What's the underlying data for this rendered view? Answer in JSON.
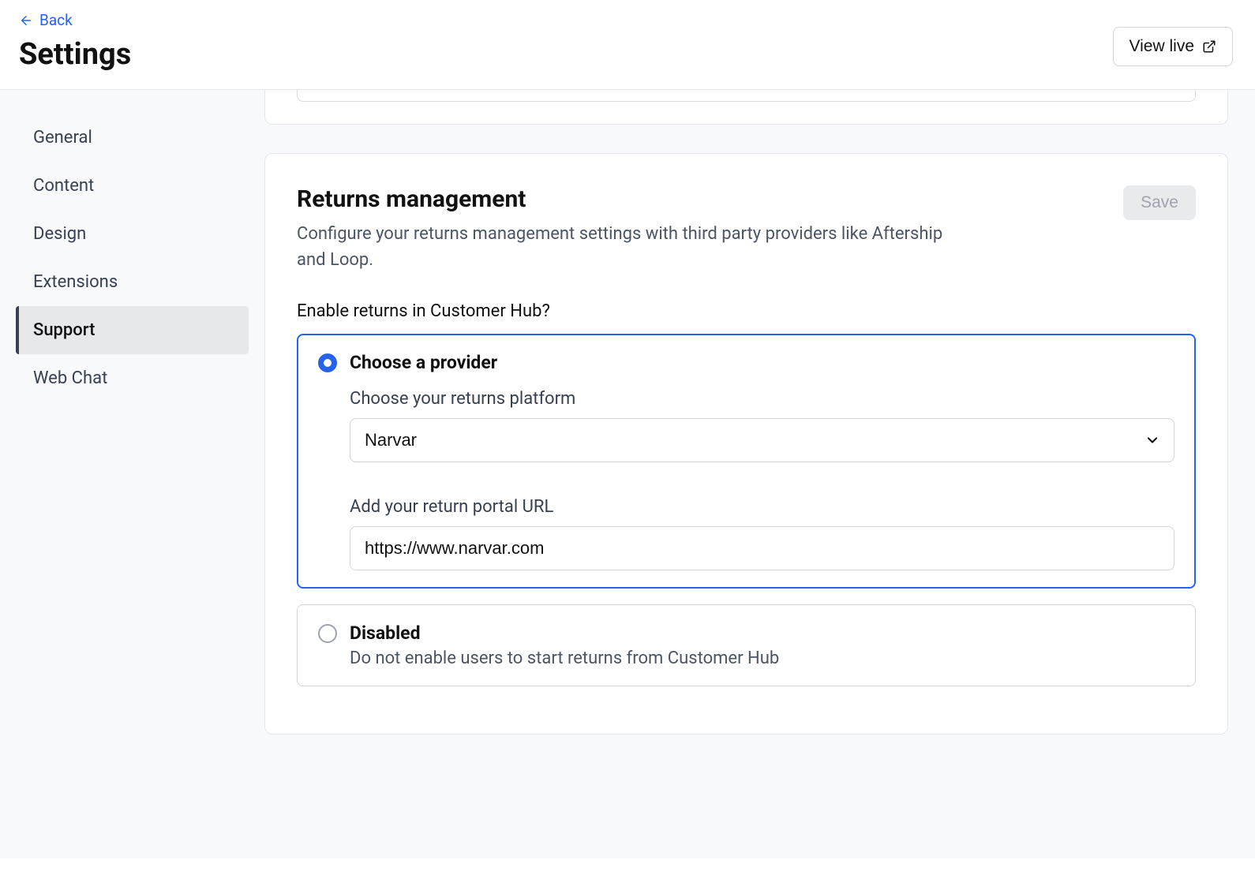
{
  "header": {
    "back_label": "Back",
    "page_title": "Settings",
    "view_live_label": "View live"
  },
  "sidebar": {
    "items": [
      {
        "label": "General",
        "active": false
      },
      {
        "label": "Content",
        "active": false
      },
      {
        "label": "Design",
        "active": false
      },
      {
        "label": "Extensions",
        "active": false
      },
      {
        "label": "Support",
        "active": true
      },
      {
        "label": "Web Chat",
        "active": false
      }
    ]
  },
  "card": {
    "title": "Returns management",
    "description": "Configure your returns management settings with third party providers like Aftership and Loop.",
    "save_label": "Save",
    "enable_label": "Enable returns in Customer Hub?",
    "option_provider": {
      "title": "Choose a provider",
      "platform_label": "Choose your returns platform",
      "platform_value": "Narvar",
      "url_label": "Add your return portal URL",
      "url_value": "https://www.narvar.com"
    },
    "option_disabled": {
      "title": "Disabled",
      "subtitle": "Do not enable users to start returns from Customer Hub"
    }
  }
}
